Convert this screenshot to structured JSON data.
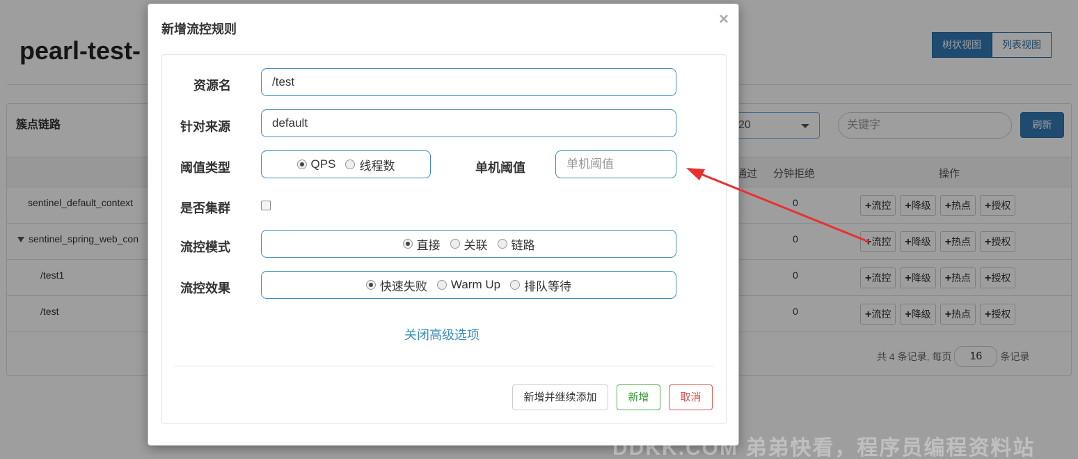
{
  "page": {
    "title": "pearl-test-",
    "view_tabs": [
      "树状视图",
      "列表视图"
    ]
  },
  "panel": {
    "title": "簇点链路",
    "context_select_value": "20",
    "keyword_placeholder": "关键字",
    "refresh_label": "刷新",
    "columns": {
      "pass": "通过",
      "reject": "分钟拒绝",
      "ops": "操作"
    },
    "rows": [
      {
        "name": "sentinel_default_context",
        "reject": "0"
      },
      {
        "name": "sentinel_spring_web_con",
        "reject": "0"
      },
      {
        "name": "/test1",
        "reject": "0"
      },
      {
        "name": "/test",
        "reject": "0"
      }
    ],
    "op_buttons": [
      "流控",
      "降级",
      "热点",
      "授权"
    ],
    "pager": {
      "prefix": "共 4 条记录, 每页",
      "page_size": "16",
      "suffix": "条记录"
    }
  },
  "modal": {
    "title": "新增流控规则",
    "close_icon": "×",
    "resource_label": "资源名",
    "resource_value": "/test",
    "source_label": "针对来源",
    "source_value": "default",
    "threshold_type_label": "阈值类型",
    "threshold_type_options": [
      "QPS",
      "线程数"
    ],
    "threshold_label": "单机阈值",
    "threshold_placeholder": "单机阈值",
    "cluster_label": "是否集群",
    "mode_label": "流控模式",
    "mode_options": [
      "直接",
      "关联",
      "链路"
    ],
    "effect_label": "流控效果",
    "effect_options": [
      "快速失败",
      "Warm Up",
      "排队等待"
    ],
    "advanced_link": "关闭高级选项",
    "add_continue_label": "新增并继续添加",
    "add_label": "新增",
    "cancel_label": "取消"
  },
  "annotation": {
    "arrow_color": "#e8312f"
  },
  "watermark": "DDKK.COM 弟弟快看，程序员编程资料站"
}
